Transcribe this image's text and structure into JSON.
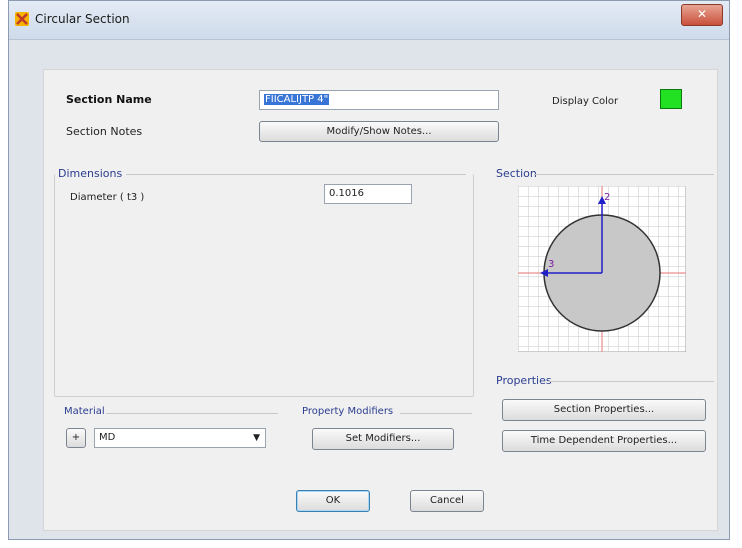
{
  "window": {
    "title": "Circular Section",
    "close_symbol": "✕"
  },
  "section_name": {
    "label": "Section Name",
    "value": "FIICALIJTP 4\""
  },
  "display_color": {
    "label": "Display Color",
    "color": "#22e022"
  },
  "section_notes": {
    "label": "Section Notes",
    "button": "Modify/Show Notes..."
  },
  "dimensions": {
    "title": "Dimensions",
    "diameter_label": "Diameter  ( t3 )",
    "diameter_value": "0.1016"
  },
  "section_preview": {
    "title": "Section",
    "axis2_label": "2",
    "axis3_label": "3"
  },
  "properties": {
    "title": "Properties",
    "section_properties_button": "Section Properties...",
    "time_dependent_button": "Time Dependent Properties..."
  },
  "material": {
    "title": "Material",
    "add_symbol": "+",
    "selected": "MD"
  },
  "property_modifiers": {
    "title": "Property Modifiers",
    "button": "Set Modifiers..."
  },
  "footer": {
    "ok": "OK",
    "cancel": "Cancel"
  }
}
